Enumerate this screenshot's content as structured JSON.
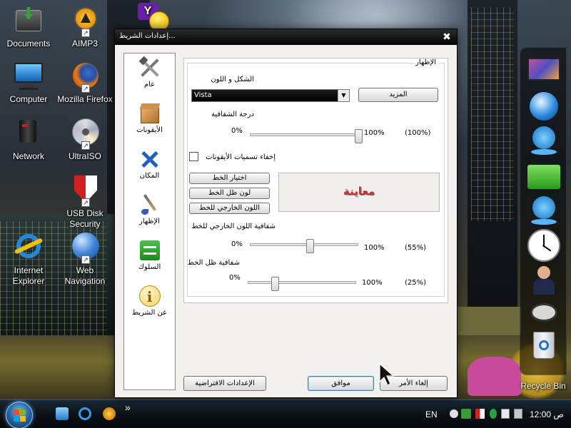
{
  "desktop": {
    "icons": [
      {
        "label": "Documents"
      },
      {
        "label": "AIMP3"
      },
      {
        "label": "Computer"
      },
      {
        "label": "Mozilla Firefox"
      },
      {
        "label": "Network"
      },
      {
        "label": "UltraISO"
      },
      {
        "label": "USB Disk Security"
      },
      {
        "label": "Internet Explorer"
      },
      {
        "label": "Web Navigation"
      }
    ],
    "recycle_bin": "Recycle Bin",
    "yahoo_letter": "Y"
  },
  "dialog": {
    "title": "إعدادات الشريط...",
    "close_glyph": "✖",
    "nav": [
      {
        "label": "عام",
        "icon": "tools-icon"
      },
      {
        "label": "الأيقونات",
        "icon": "box-icon"
      },
      {
        "label": "المكان",
        "icon": "move-arrows-icon"
      },
      {
        "label": "الإظهار",
        "icon": "paintbrush-icon"
      },
      {
        "label": "السلوك",
        "icon": "swap-arrows-icon"
      },
      {
        "label": "عن الشريط",
        "icon": "info-icon"
      }
    ],
    "group_title": "الإظهار",
    "shape_color_label": "الشكل و اللون",
    "style_value": "Vista",
    "more_button": "المزيد",
    "transparency_label": "درجة الشفافية",
    "transparency": {
      "min": "0%",
      "max": "100%",
      "value_text": "(100%)",
      "value": 100
    },
    "hide_names_label": "إخفاء تسميات الأيقونات",
    "hide_names_checked": false,
    "font_button": "اختيار الخط",
    "shadow_color_button": "لون ظل الخط",
    "outline_color_button": "اللون الخارجي للخط",
    "preview_text": "معاينة",
    "outline_transparency_label": "شفافية اللون الخارجي للخط",
    "outline_transparency": {
      "min": "0%",
      "max": "100%",
      "value_text": "(55%)",
      "value": 55
    },
    "shadow_transparency_label": "شفافية ظل الخط",
    "shadow_transparency": {
      "min": "0%",
      "max": "100%",
      "value_text": "(25%)",
      "value": 25
    },
    "defaults_button": "الإعدادات الافتراضية",
    "ok_button": "موافق",
    "cancel_button": "إلغاء الأمر"
  },
  "taskbar": {
    "chevron": "»",
    "language": "EN",
    "clock": "12:00 ص"
  }
}
